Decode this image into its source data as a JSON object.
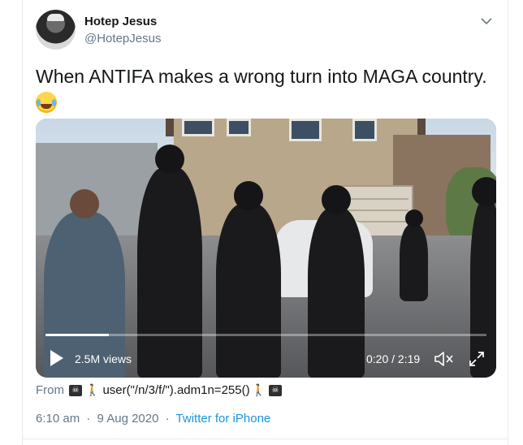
{
  "author": {
    "display_name": "Hotep Jesus",
    "handle": "@HotepJesus"
  },
  "tweet": {
    "text": "When ANTIFA makes a wrong turn into MAGA country.",
    "emoji": "face-with-tears-of-joy"
  },
  "video": {
    "views": "2.5M views",
    "time": "0:20 / 2:19",
    "progress_fraction": 0.144
  },
  "source": {
    "prefix": "From",
    "app_name": "user(\"/n/3/f/\").adm1n=255()",
    "left_glyph": "🚶",
    "right_glyph": "🚶"
  },
  "meta": {
    "time": "6:10 am",
    "date": "9 Aug 2020",
    "separator": "·",
    "client": "Twitter for iPhone"
  },
  "colors": {
    "text": "#14171a",
    "secondary": "#657786",
    "link": "#1b95e0"
  }
}
